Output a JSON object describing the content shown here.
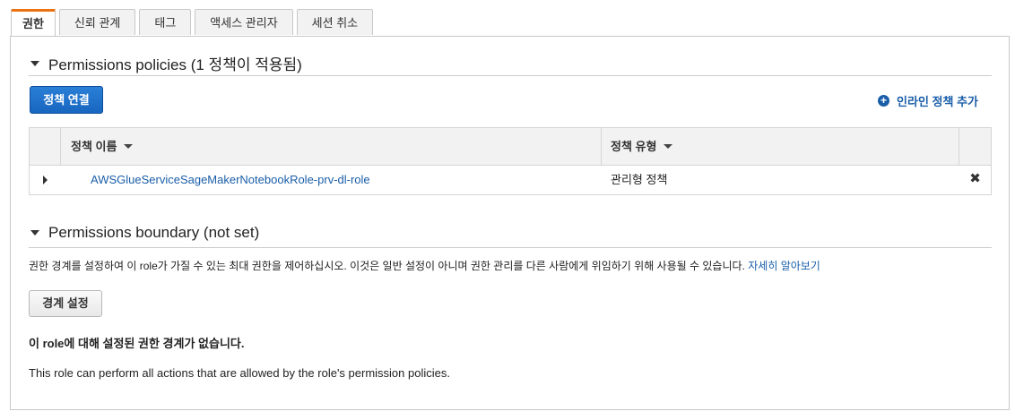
{
  "tabs": [
    {
      "label": "권한",
      "active": true
    },
    {
      "label": "신뢰 관계",
      "active": false
    },
    {
      "label": "태그",
      "active": false
    },
    {
      "label": "액세스 관리자",
      "active": false
    },
    {
      "label": "세션 취소",
      "active": false
    }
  ],
  "policies": {
    "title": "Permissions policies (1 정책이 적용됨)",
    "attach_button": "정책 연결",
    "add_inline_label": "인라인 정책 추가",
    "columns": {
      "name": "정책 이름",
      "type": "정책 유형"
    },
    "rows": [
      {
        "name": "AWSGlueServiceSageMakerNotebookRole-prv-dl-role",
        "type": "관리형 정책"
      }
    ]
  },
  "boundary": {
    "title": "Permissions boundary (not set)",
    "description": "권한 경계를 설정하여 이 role가 가질 수 있는 최대 권한을 제어하십시오. 이것은 일반 설정이 아니며 권한 관리를 다른 사람에게 위임하기 위해 사용될 수 있습니다.",
    "learn_more": "자세히 알아보기",
    "set_button": "경계 설정",
    "notice": "이 role에 대해 설정된 권한 경계가 없습니다.",
    "info": "This role can perform all actions that are allowed by the role's permission policies."
  },
  "colors": {
    "accent_tab": "#ec7211",
    "primary": "#1766c0",
    "link": "#1a5ea8"
  }
}
